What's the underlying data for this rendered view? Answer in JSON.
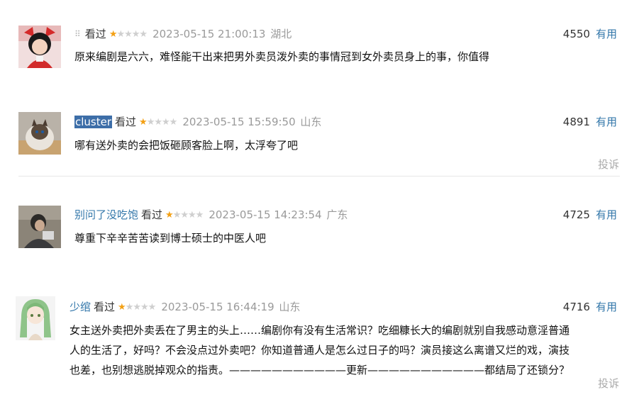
{
  "comments": [
    {
      "user": "",
      "status": "看过",
      "rating": 1,
      "time": "2023-05-15 21:00:13",
      "location": "湖北",
      "votes": "4550",
      "useful": "有用",
      "text": "原来编剧是六六，难怪能干出来把男外卖员泼外卖的事情冠到女外卖员身上的事，你值得",
      "report": ""
    },
    {
      "user": "cluster",
      "status": "看过",
      "rating": 1,
      "time": "2023-05-15 15:59:50",
      "location": "山东",
      "votes": "4891",
      "useful": "有用",
      "text": "哪有送外卖的会把饭砸顾客脸上啊，太浮夸了吧",
      "report": "投诉"
    },
    {
      "user": "别问了没吃饱",
      "status": "看过",
      "rating": 1,
      "time": "2023-05-15 14:23:54",
      "location": "广东",
      "votes": "4725",
      "useful": "有用",
      "text": "尊重下辛辛苦苦读到博士硕士的中医人吧",
      "report": ""
    },
    {
      "user": "少绾",
      "status": "看过",
      "rating": 1,
      "time": "2023-05-15 16:44:19",
      "location": "山东",
      "votes": "4716",
      "useful": "有用",
      "text_lines": [
        "女主送外卖把外卖丢在了男主的头上……编剧你有没有生活常识？吃细糠长大的编剧就别自我感动意淫普通",
        "人的生活了，好吗？不会没点过外卖吧？你知道普通人是怎么过日子的吗？演员接这么离谱又烂的戏，演技",
        "也差，也别想逃脱掉观众的指责。———————————更新———————————都结局了还锁分？"
      ],
      "report": "投诉"
    }
  ],
  "icons": {
    "drag_handle": "drag-handle-icon",
    "star": "star-icon"
  },
  "colors": {
    "link": "#3377aa",
    "star_on": "#f3a014",
    "star_off": "#cfcfcf",
    "muted": "#9a9a9a"
  }
}
